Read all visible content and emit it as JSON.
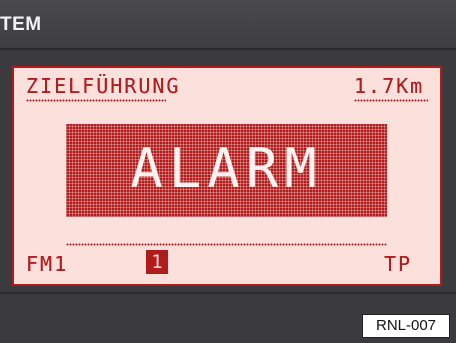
{
  "header": {
    "brand_fragment": "TEM"
  },
  "display": {
    "title": "ZIELFÜHRUNG",
    "distance": "1.7Km",
    "alert": "ALARM",
    "band": "FM1",
    "preset": "1",
    "traffic_program": "TP"
  },
  "caption": {
    "code": "RNL-007"
  },
  "colors": {
    "lcd_background": "#fbe0dc",
    "lcd_segment": "#b21e1e",
    "bezel": "#3b3b3d"
  }
}
